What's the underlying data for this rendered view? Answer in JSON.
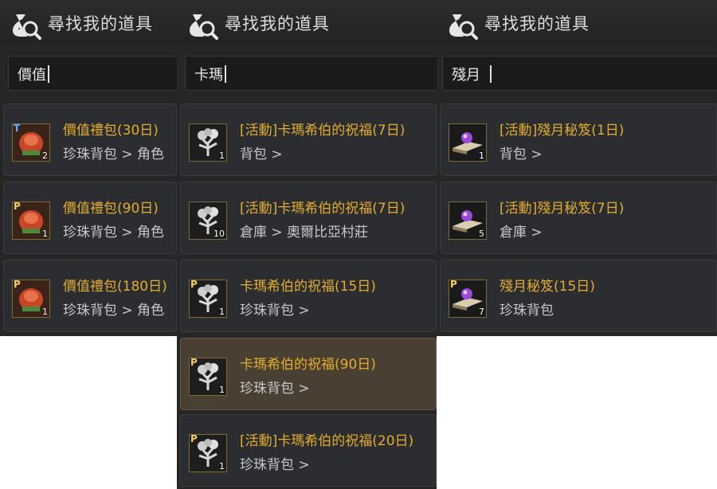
{
  "panels": [
    {
      "title": "尋找我的道具",
      "search_value": "價值",
      "items": [
        {
          "name": "價值禮包(30日)",
          "location": "珍珠背包 > 角色",
          "badge": "T",
          "count": "2",
          "icon": "gift-box-icon"
        },
        {
          "name": "價值禮包(90日)",
          "location": "珍珠背包 > 角色",
          "badge": "P",
          "count": "1",
          "icon": "gift-box-icon"
        },
        {
          "name": "價值禮包(180日)",
          "location": "珍珠背包 > 角色",
          "badge": "P",
          "count": "1",
          "icon": "gift-box-icon"
        }
      ]
    },
    {
      "title": "尋找我的道具",
      "search_value": "卡瑪",
      "items": [
        {
          "name": "[活動]卡瑪希伯的祝福(7日)",
          "location": "背包 >",
          "badge": "",
          "count": "1",
          "icon": "blessing-tree-icon"
        },
        {
          "name": "[活動]卡瑪希伯的祝福(7日)",
          "location": "倉庫 > 奧爾比亞村莊",
          "badge": "",
          "count": "10",
          "icon": "blessing-tree-icon"
        },
        {
          "name": "卡瑪希伯的祝福(15日)",
          "location": "珍珠背包 >",
          "badge": "P",
          "count": "1",
          "icon": "blessing-tree-icon"
        },
        {
          "name": "卡瑪希伯的祝福(90日)",
          "location": "珍珠背包 >",
          "badge": "P",
          "count": "1",
          "icon": "blessing-tree-icon"
        },
        {
          "name": "[活動]卡瑪希伯的祝福(20日)",
          "location": "珍珠背包 >",
          "badge": "P",
          "count": "1",
          "icon": "blessing-tree-icon"
        }
      ]
    },
    {
      "title": "尋找我的道具",
      "search_value": "殘月",
      "items": [
        {
          "name": "[活動]殘月秘笈(1日)",
          "location": "背包 >",
          "badge": "",
          "count": "1",
          "icon": "secret-book-icon"
        },
        {
          "name": "[活動]殘月秘笈(7日)",
          "location": "倉庫 >",
          "badge": "",
          "count": "5",
          "icon": "secret-book-icon"
        },
        {
          "name": "殘月秘笈(15日)",
          "location": "珍珠背包",
          "badge": "P",
          "count": "7",
          "icon": "secret-book-icon"
        }
      ]
    }
  ],
  "selected": {
    "panel": 1,
    "item": 3
  },
  "colors": {
    "item_name": "#e3ad2c",
    "panel_bg": "#262626",
    "selected_bg": "#4a3f33"
  }
}
